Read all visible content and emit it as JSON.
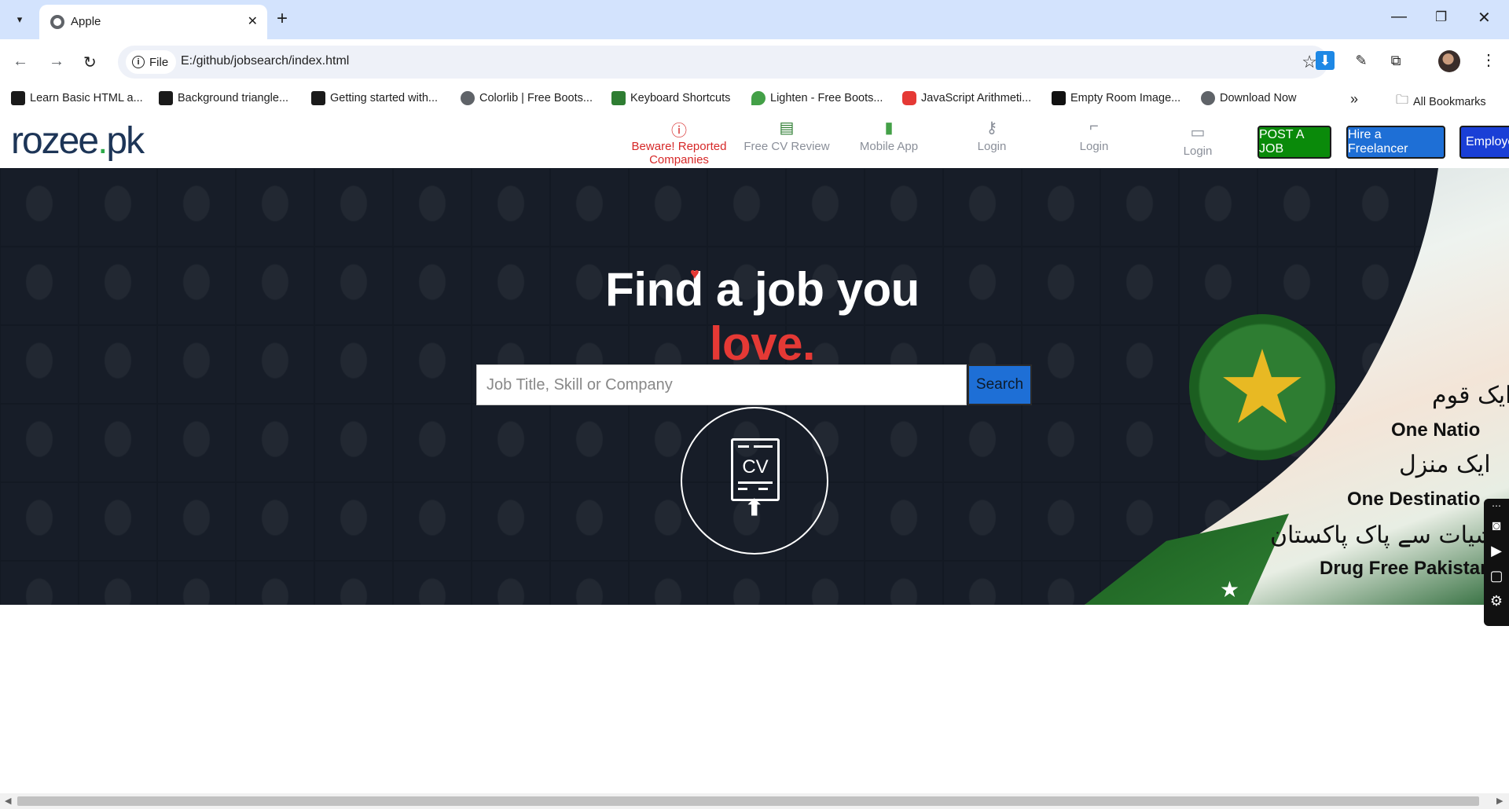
{
  "browser": {
    "tab_title": "Apple",
    "url": "E:/github/jobsearch/index.html",
    "site_info_label": "File",
    "all_bookmarks": "All Bookmarks",
    "bookmarks": [
      {
        "label": "Learn Basic HTML a...",
        "color": "#1a1a1a"
      },
      {
        "label": "Background triangle...",
        "color": "#1a1a1a"
      },
      {
        "label": "Getting started with...",
        "color": "#1a1a1a"
      },
      {
        "label": "Colorlib | Free Boots...",
        "color": "#5f6368"
      },
      {
        "label": "Keyboard Shortcuts",
        "color": "#2e7d32"
      },
      {
        "label": "Lighten - Free Boots...",
        "color": "#43a047"
      },
      {
        "label": "JavaScript Arithmeti...",
        "color": "#e53935"
      },
      {
        "label": "Empty Room Image...",
        "color": "#111111"
      },
      {
        "label": "Download Now",
        "color": "#5f6368"
      }
    ]
  },
  "header": {
    "logo_main": "rozee",
    "logo_dot": ".",
    "logo_tld": "pk",
    "nav": [
      {
        "label": "Beware! Reported Companies",
        "icon": "alert-icon"
      },
      {
        "label": "Free CV Review",
        "icon": "cv-icon"
      },
      {
        "label": "Mobile App",
        "icon": "phone-icon"
      },
      {
        "label": "Login",
        "icon": "key-icon"
      },
      {
        "label": "Login",
        "icon": "stairs-icon"
      },
      {
        "label": "Login",
        "icon": "id-card-icon"
      }
    ],
    "buttons": [
      {
        "label": "POST A JOB",
        "color": "#0a8a0a"
      },
      {
        "label": "Hire a Freelancer",
        "color": "#1e6fd6"
      },
      {
        "label": "Employe",
        "color": "#1a3fd6"
      }
    ]
  },
  "hero": {
    "title_part1": "Find a job you ",
    "title_part2": "love.",
    "search_placeholder": "Job Title, Skill or Company",
    "search_button": "Search",
    "cv_label": "CV"
  },
  "banner": {
    "urdu_line1": "ایک قوم",
    "english_line1": "One Natio",
    "urdu_line2": "ایک منزل",
    "english_line2": "One Destinatio",
    "urdu_line3": "منشیات سے پاک پاکستان",
    "english_line3": "Drug Free Pakistan"
  }
}
